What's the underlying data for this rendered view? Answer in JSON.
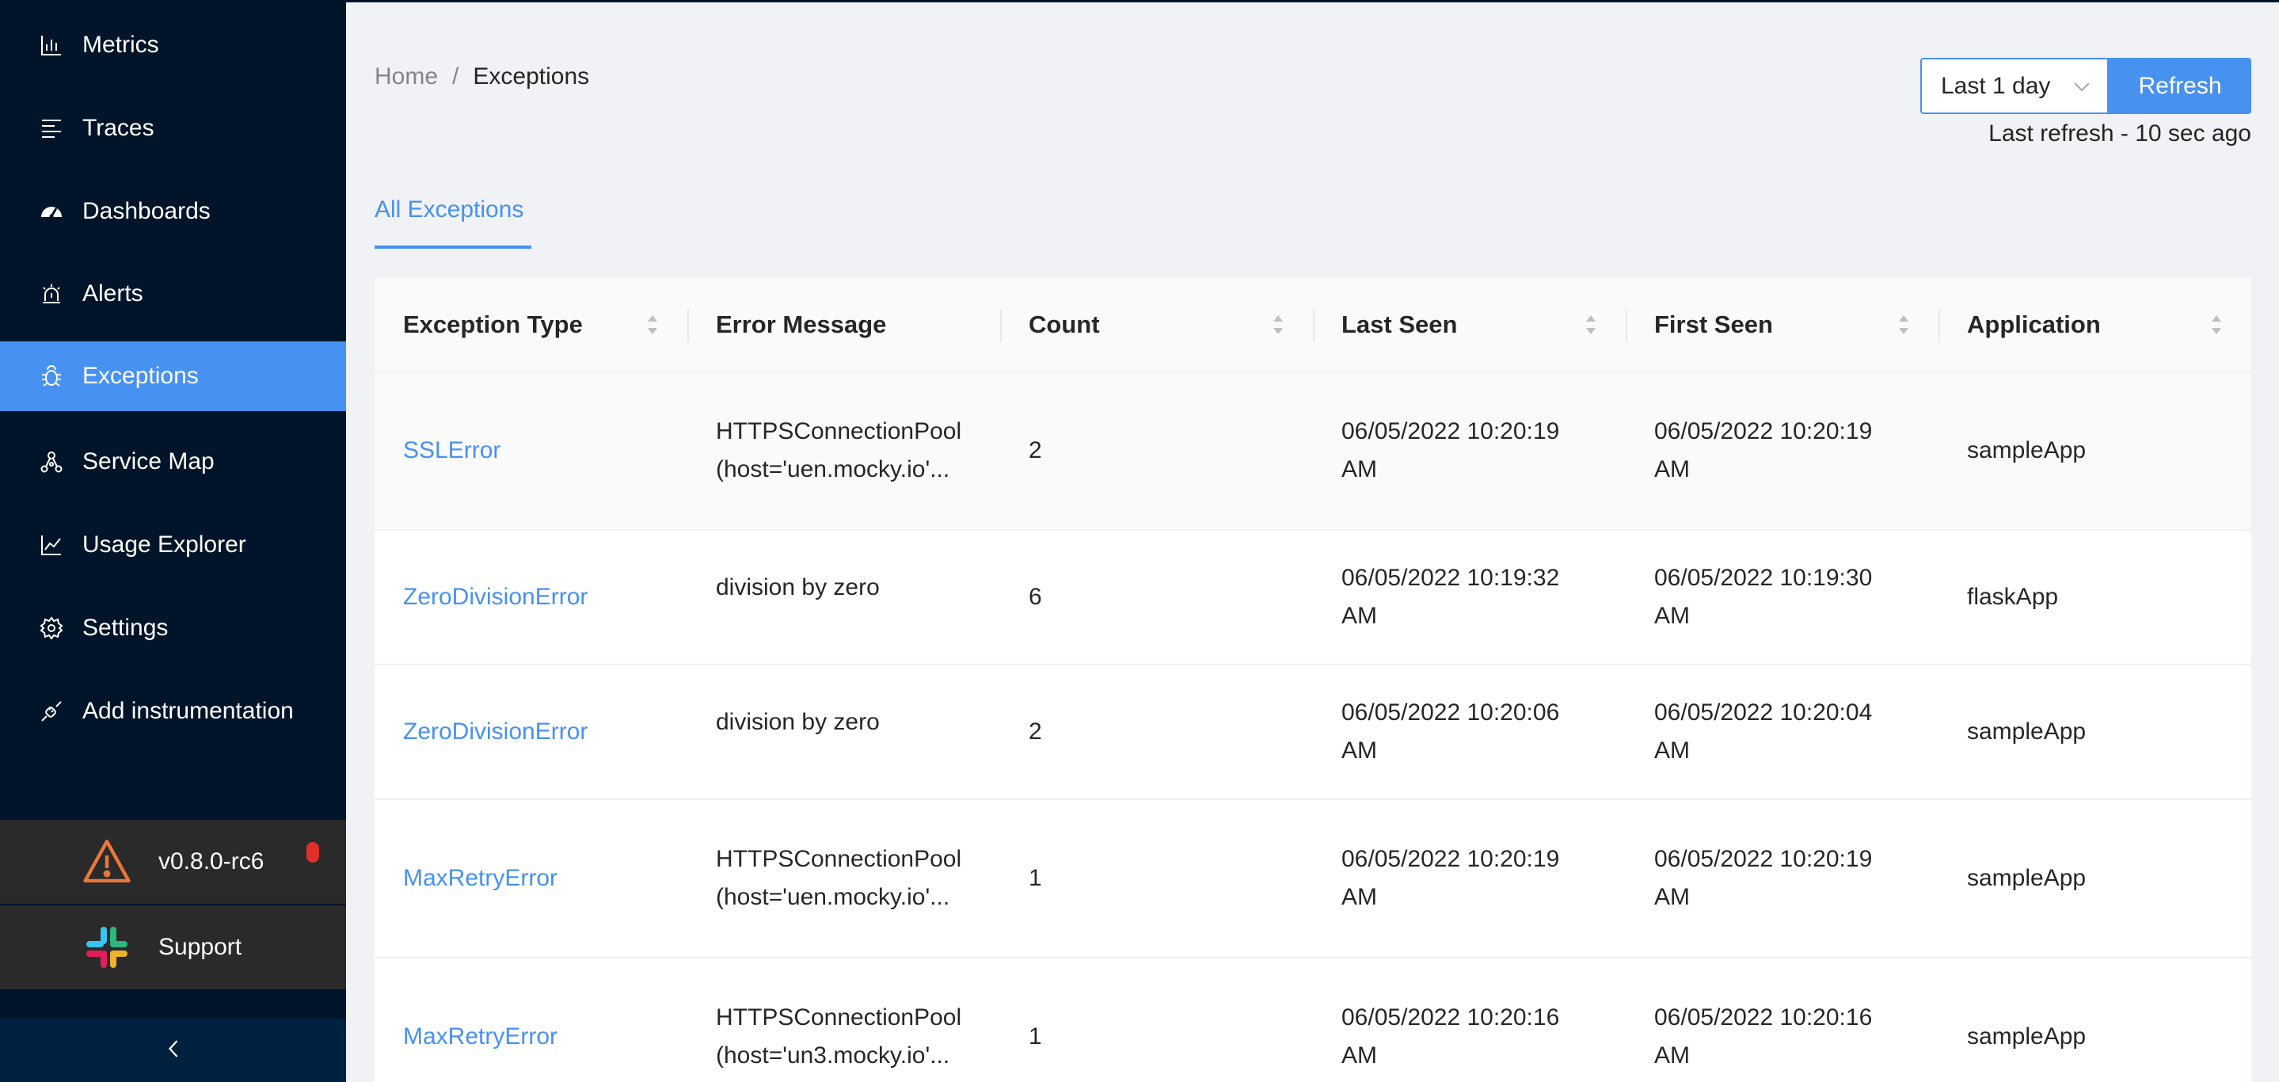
{
  "sidebar": {
    "items": [
      {
        "label": "Metrics",
        "icon": "bar-chart-icon"
      },
      {
        "label": "Traces",
        "icon": "align-left-icon"
      },
      {
        "label": "Dashboards",
        "icon": "dashboard-icon"
      },
      {
        "label": "Alerts",
        "icon": "alarm-icon"
      },
      {
        "label": "Exceptions",
        "icon": "bug-icon",
        "active": true
      },
      {
        "label": "Service Map",
        "icon": "deployment-unit-icon"
      },
      {
        "label": "Usage Explorer",
        "icon": "line-chart-icon"
      },
      {
        "label": "Settings",
        "icon": "gear-icon"
      },
      {
        "label": "Add instrumentation",
        "icon": "api-icon"
      }
    ],
    "version": "v0.8.0-rc6",
    "support": "Support",
    "collapse_glyph": "<"
  },
  "breadcrumb": {
    "home": "Home",
    "separator": "/",
    "current": "Exceptions"
  },
  "toolbar": {
    "time_range": "Last 1 day",
    "refresh_label": "Refresh",
    "last_refresh": "Last refresh - 10 sec ago"
  },
  "tabs": {
    "active": "All Exceptions"
  },
  "table": {
    "columns": [
      "Exception Type",
      "Error Message",
      "Count",
      "Last Seen",
      "First Seen",
      "Application"
    ],
    "rows": [
      {
        "type": "SSLError",
        "message_line1": "HTTPSConnectionPool",
        "message_line2": "(host='uen.mocky.io'...",
        "count": "2",
        "last_seen_line1": "06/05/2022 10:20:19",
        "last_seen_line2": "AM",
        "first_seen_line1": "06/05/2022 10:20:19",
        "first_seen_line2": "AM",
        "application": "sampleApp"
      },
      {
        "type": "ZeroDivisionError",
        "message_line1": "division by zero",
        "message_line2": "",
        "count": "6",
        "last_seen_line1": "06/05/2022 10:19:32",
        "last_seen_line2": "AM",
        "first_seen_line1": "06/05/2022 10:19:30",
        "first_seen_line2": "AM",
        "application": "flaskApp"
      },
      {
        "type": "ZeroDivisionError",
        "message_line1": "division by zero",
        "message_line2": "",
        "count": "2",
        "last_seen_line1": "06/05/2022 10:20:06",
        "last_seen_line2": "AM",
        "first_seen_line1": "06/05/2022 10:20:04",
        "first_seen_line2": "AM",
        "application": "sampleApp"
      },
      {
        "type": "MaxRetryError",
        "message_line1": "HTTPSConnectionPool",
        "message_line2": "(host='uen.mocky.io'...",
        "count": "1",
        "last_seen_line1": "06/05/2022 10:20:19",
        "last_seen_line2": "AM",
        "first_seen_line1": "06/05/2022 10:20:19",
        "first_seen_line2": "AM",
        "application": "sampleApp"
      },
      {
        "type": "MaxRetryError",
        "message_line1": "HTTPSConnectionPool",
        "message_line2": "(host='un3.mocky.io'...",
        "count": "1",
        "last_seen_line1": "06/05/2022 10:20:16",
        "last_seen_line2": "AM",
        "first_seen_line1": "06/05/2022 10:20:16",
        "first_seen_line2": "AM",
        "application": "sampleApp"
      }
    ]
  },
  "colors": {
    "sidebar_bg": "#001529",
    "accent": "#4791f0",
    "bottom_block_bg": "#2a2a2a",
    "warning": "#e8773a",
    "notification_dot": "#e0302b"
  }
}
